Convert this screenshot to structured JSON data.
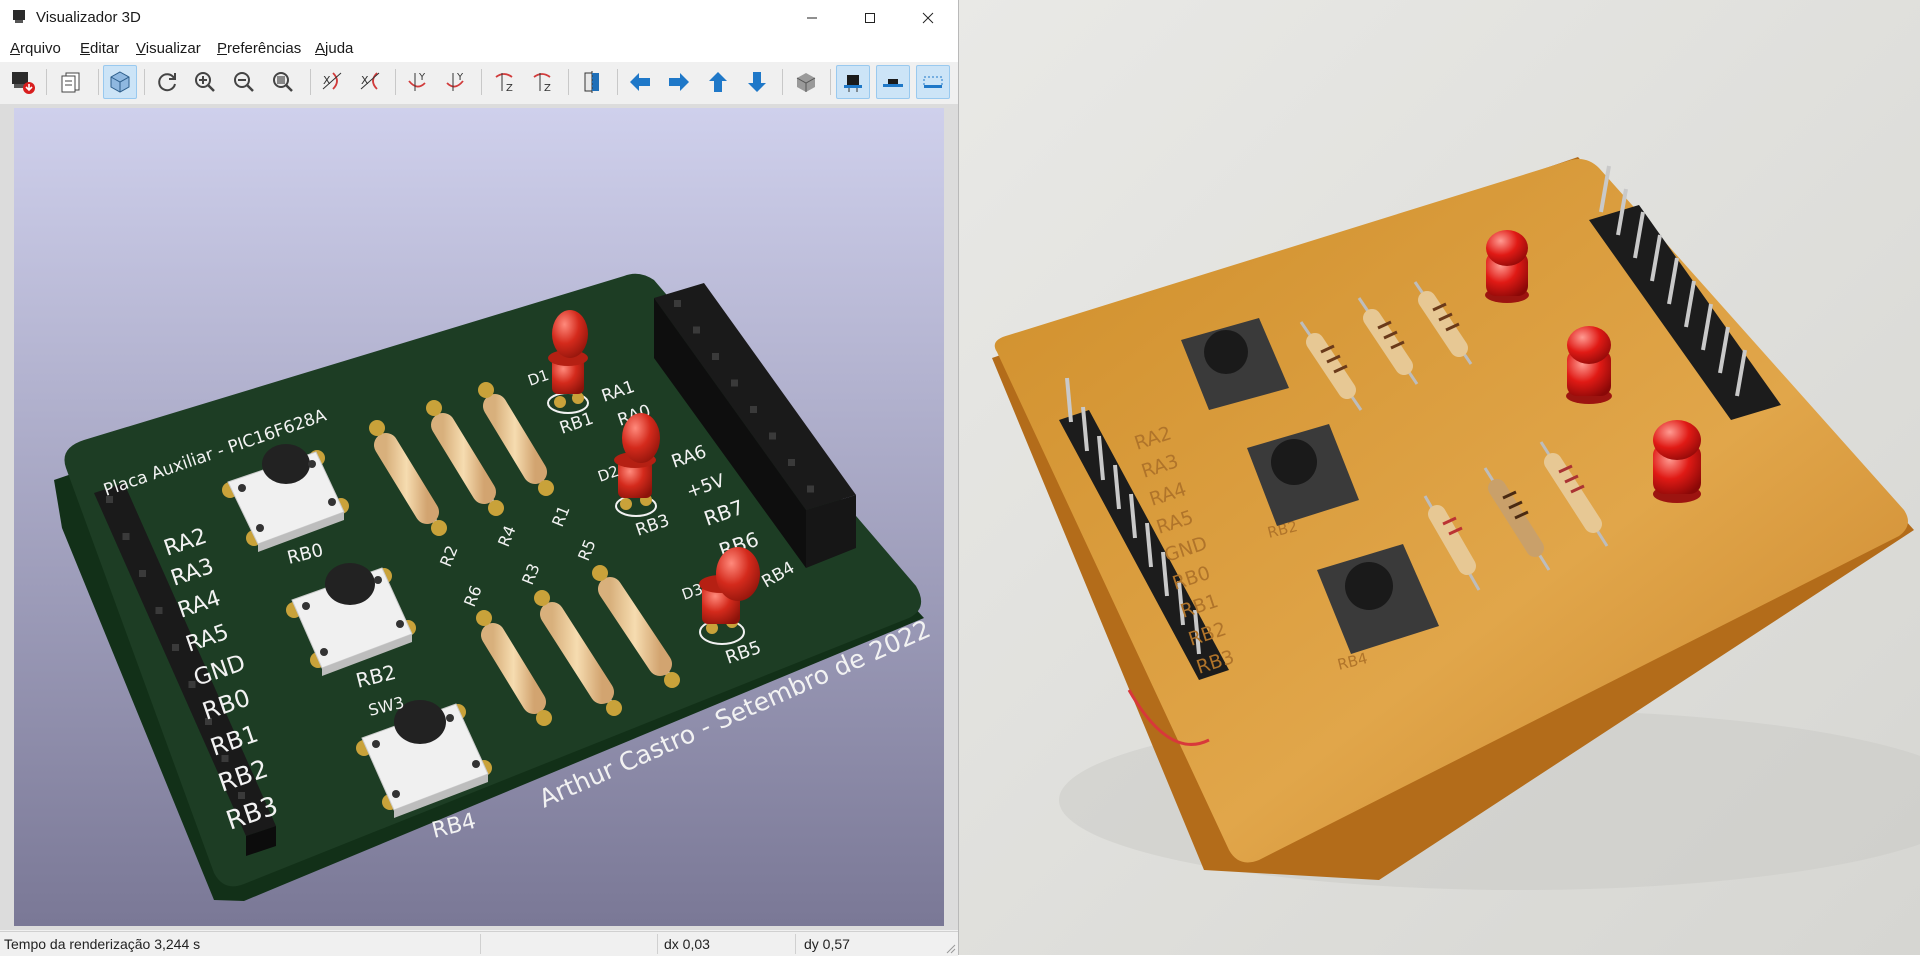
{
  "window": {
    "title": "Visualizador 3D"
  },
  "menu": {
    "items": [
      {
        "underline": "A",
        "rest": "rquivo"
      },
      {
        "underline": "E",
        "rest": "ditar"
      },
      {
        "underline": "V",
        "rest": "isualizar"
      },
      {
        "underline": "P",
        "rest": "referências"
      },
      {
        "underline": "A",
        "rest": "juda"
      }
    ]
  },
  "toolbar": {
    "icons": [
      "export-icon",
      "copy-icon",
      "perspective-icon",
      "reload-icon",
      "zoom-in-icon",
      "zoom-out-icon",
      "zoom-fit-icon",
      "rotate-x-cw-icon",
      "rotate-x-ccw-icon",
      "rotate-y-cw-icon",
      "rotate-y-ccw-icon",
      "rotate-z-cw-icon",
      "rotate-z-ccw-icon",
      "flip-board-icon",
      "pan-left-icon",
      "pan-right-icon",
      "pan-up-icon",
      "pan-down-icon",
      "ortho-icon",
      "toggle-through-hole-icon",
      "toggle-smd-icon",
      "toggle-virtual-icon"
    ]
  },
  "board": {
    "title": "Placa Auxiliar - PIC16F628A",
    "footer": "Arthur Castro - Setembro de 2022",
    "left_pins": [
      "RA2",
      "RA3",
      "RA4",
      "RA5",
      "GND",
      "RB0",
      "RB1",
      "RB2",
      "RB3"
    ],
    "right_pins": [
      "RA1",
      "RA0",
      "RA6",
      "+5V",
      "RB7",
      "RB6",
      "RB5",
      "RB4"
    ],
    "buttons": [
      "RB0",
      "RB2",
      "RB4"
    ],
    "button_ref": "SW3",
    "resistors": [
      "R2",
      "R4",
      "R1",
      "R6",
      "R3",
      "R5"
    ],
    "leds": [
      {
        "ref": "D1",
        "label": "RB1"
      },
      {
        "ref": "D2",
        "label": "RB3"
      },
      {
        "ref": "D3",
        "label": "RB5"
      }
    ]
  },
  "photo_board": {
    "left_pins": [
      "RA2",
      "RA3",
      "RA4",
      "RA5",
      "GND",
      "RB0",
      "RB1",
      "RB2",
      "RB3"
    ],
    "labels": [
      "RB2",
      "RB4"
    ]
  },
  "status": {
    "render_time": "Tempo da renderização 3,244 s",
    "dx": "dx 0,03",
    "dy": "dy 0,57"
  },
  "colors": {
    "pcb": "#1c3b22",
    "accent": "#0078d4",
    "led": "#d42a1c"
  }
}
